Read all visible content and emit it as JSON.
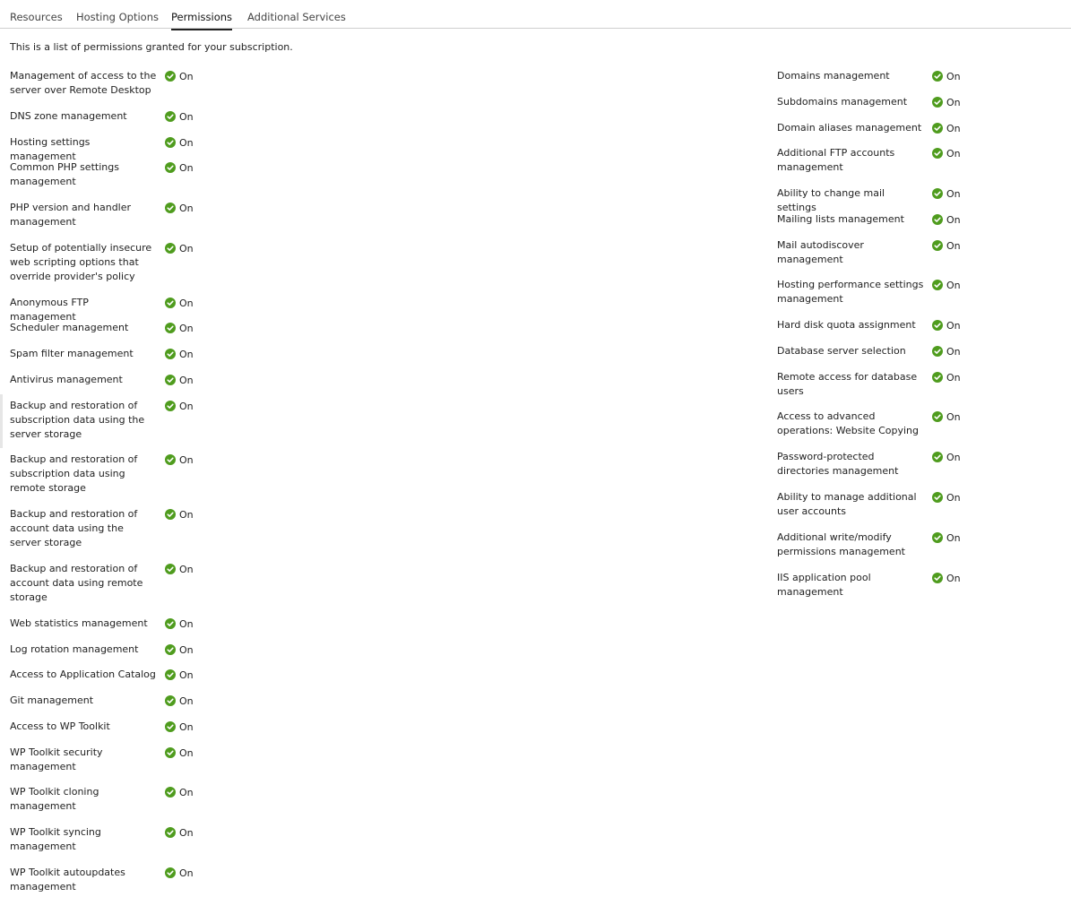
{
  "tabs": [
    {
      "label": "Resources"
    },
    {
      "label": "Hosting Options"
    },
    {
      "label": "Permissions"
    },
    {
      "label": "Additional Services"
    }
  ],
  "intro": "This is a list of permissions granted for your subscription.",
  "status_color": "#4f9c1e",
  "left_permissions": [
    {
      "name": "Management of access to the server over Remote Desktop",
      "status": "On"
    },
    {
      "name": "DNS zone management",
      "status": "On"
    },
    {
      "name": "Hosting settings management",
      "status": "On"
    },
    {
      "name": "Common PHP settings management",
      "status": "On"
    },
    {
      "name": "PHP version and handler management",
      "status": "On"
    },
    {
      "name": "Setup of potentially insecure web scripting options that override provider's policy",
      "status": "On"
    },
    {
      "name": "Anonymous FTP management",
      "status": "On"
    },
    {
      "name": "Scheduler management",
      "status": "On"
    },
    {
      "name": "Spam filter management",
      "status": "On"
    },
    {
      "name": "Antivirus management",
      "status": "On"
    },
    {
      "name": "Backup and restoration of subscription data using the server storage",
      "status": "On"
    },
    {
      "name": "Backup and restoration of subscription data using remote storage",
      "status": "On"
    },
    {
      "name": "Backup and restoration of account data using the server storage",
      "status": "On"
    },
    {
      "name": "Backup and restoration of account data using remote storage",
      "status": "On"
    },
    {
      "name": "Web statistics management",
      "status": "On"
    },
    {
      "name": "Log rotation management",
      "status": "On"
    },
    {
      "name": "Access to Application Catalog",
      "status": "On"
    },
    {
      "name": "Git management",
      "status": "On"
    },
    {
      "name": "Access to WP Toolkit",
      "status": "On"
    },
    {
      "name": "WP Toolkit security management",
      "status": "On"
    },
    {
      "name": "WP Toolkit cloning management",
      "status": "On"
    },
    {
      "name": "WP Toolkit syncing management",
      "status": "On"
    },
    {
      "name": "WP Toolkit autoupdates management",
      "status": "On"
    }
  ],
  "right_permissions": [
    {
      "name": "Domains management",
      "status": "On"
    },
    {
      "name": "Subdomains management",
      "status": "On"
    },
    {
      "name": "Domain aliases management",
      "status": "On"
    },
    {
      "name": "Additional FTP accounts management",
      "status": "On"
    },
    {
      "name": "Ability to change mail settings",
      "status": "On"
    },
    {
      "name": "Mailing lists management",
      "status": "On"
    },
    {
      "name": "Mail autodiscover management",
      "status": "On"
    },
    {
      "name": "Hosting performance settings management",
      "status": "On"
    },
    {
      "name": "Hard disk quota assignment",
      "status": "On"
    },
    {
      "name": "Database server selection",
      "status": "On"
    },
    {
      "name": "Remote access for database users",
      "status": "On"
    },
    {
      "name": "Access to advanced operations: Website Copying",
      "status": "On"
    },
    {
      "name": "Password-protected directories management",
      "status": "On"
    },
    {
      "name": "Ability to manage additional user accounts",
      "status": "On"
    },
    {
      "name": "Additional write/modify permissions management",
      "status": "On"
    },
    {
      "name": "IIS application pool management",
      "status": "On"
    }
  ]
}
